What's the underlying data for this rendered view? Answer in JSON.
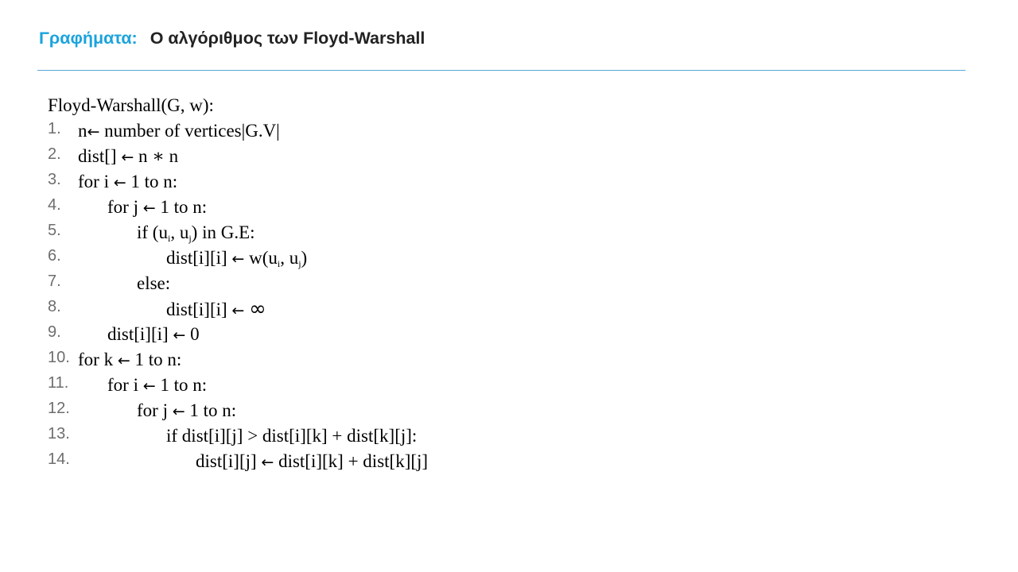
{
  "header": {
    "topic": "Γραφήματα:",
    "title": "Ο αλγόριθμος των Floyd-Warshall"
  },
  "algorithm": {
    "signature": "Floyd-Warshall(G, w):",
    "lines": [
      {
        "number": "1.",
        "indent": 0,
        "segments": [
          {
            "type": "text",
            "value": "n"
          },
          {
            "type": "arrow",
            "value": "←"
          },
          {
            "type": "text",
            "value": " number of vertices|G.V|"
          }
        ]
      },
      {
        "number": "2.",
        "indent": 0,
        "segments": [
          {
            "type": "text",
            "value": "dist[] "
          },
          {
            "type": "arrow",
            "value": "←"
          },
          {
            "type": "text",
            "value": " n ∗ n"
          }
        ]
      },
      {
        "number": "3.",
        "indent": 0,
        "segments": [
          {
            "type": "text",
            "value": "for i "
          },
          {
            "type": "arrow",
            "value": "←"
          },
          {
            "type": "text",
            "value": " 1 to n:"
          }
        ]
      },
      {
        "number": "4.",
        "indent": 1,
        "segments": [
          {
            "type": "text",
            "value": "for j "
          },
          {
            "type": "arrow",
            "value": "←"
          },
          {
            "type": "text",
            "value": " 1 to n:"
          }
        ]
      },
      {
        "number": "5.",
        "indent": 2,
        "segments": [
          {
            "type": "text",
            "value": "if (u"
          },
          {
            "type": "sub",
            "value": "i"
          },
          {
            "type": "text",
            "value": ", u"
          },
          {
            "type": "sub",
            "value": "j"
          },
          {
            "type": "text",
            "value": ") in G.E:"
          }
        ]
      },
      {
        "number": "6.",
        "indent": 3,
        "segments": [
          {
            "type": "text",
            "value": "dist[i][i] "
          },
          {
            "type": "arrow",
            "value": "←"
          },
          {
            "type": "text",
            "value": " w(u"
          },
          {
            "type": "sub",
            "value": "i"
          },
          {
            "type": "text",
            "value": ", u"
          },
          {
            "type": "sub",
            "value": "j"
          },
          {
            "type": "text",
            "value": ")"
          }
        ]
      },
      {
        "number": "7.",
        "indent": 2,
        "segments": [
          {
            "type": "text",
            "value": "else:"
          }
        ]
      },
      {
        "number": "8.",
        "indent": 3,
        "segments": [
          {
            "type": "text",
            "value": "dist[i][i] "
          },
          {
            "type": "arrow",
            "value": "←"
          },
          {
            "type": "text",
            "value": " "
          },
          {
            "type": "infinity",
            "value": "∞"
          }
        ]
      },
      {
        "number": "9.",
        "indent": 1,
        "segments": [
          {
            "type": "text",
            "value": "dist[i][i] "
          },
          {
            "type": "arrow",
            "value": "←"
          },
          {
            "type": "text",
            "value": " 0"
          }
        ]
      },
      {
        "number": "10.",
        "indent": 0,
        "segments": [
          {
            "type": "text",
            "value": "for k "
          },
          {
            "type": "arrow",
            "value": "←"
          },
          {
            "type": "text",
            "value": " 1 to n:"
          }
        ]
      },
      {
        "number": "11.",
        "indent": 1,
        "segments": [
          {
            "type": "text",
            "value": "for i "
          },
          {
            "type": "arrow",
            "value": "←"
          },
          {
            "type": "text",
            "value": " 1 to n:"
          }
        ]
      },
      {
        "number": "12.",
        "indent": 2,
        "segments": [
          {
            "type": "text",
            "value": "for j "
          },
          {
            "type": "arrow",
            "value": "←"
          },
          {
            "type": "text",
            "value": " 1 to n:"
          }
        ]
      },
      {
        "number": "13.",
        "indent": 3,
        "segments": [
          {
            "type": "text",
            "value": "if dist[i][j] > dist[i][k] + dist[k][j]:"
          }
        ]
      },
      {
        "number": "14.",
        "indent": 4,
        "segments": [
          {
            "type": "text",
            "value": "dist[i][j] "
          },
          {
            "type": "arrow",
            "value": "←"
          },
          {
            "type": "text",
            "value": " dist[i][k] + dist[k][j]"
          }
        ]
      }
    ]
  }
}
